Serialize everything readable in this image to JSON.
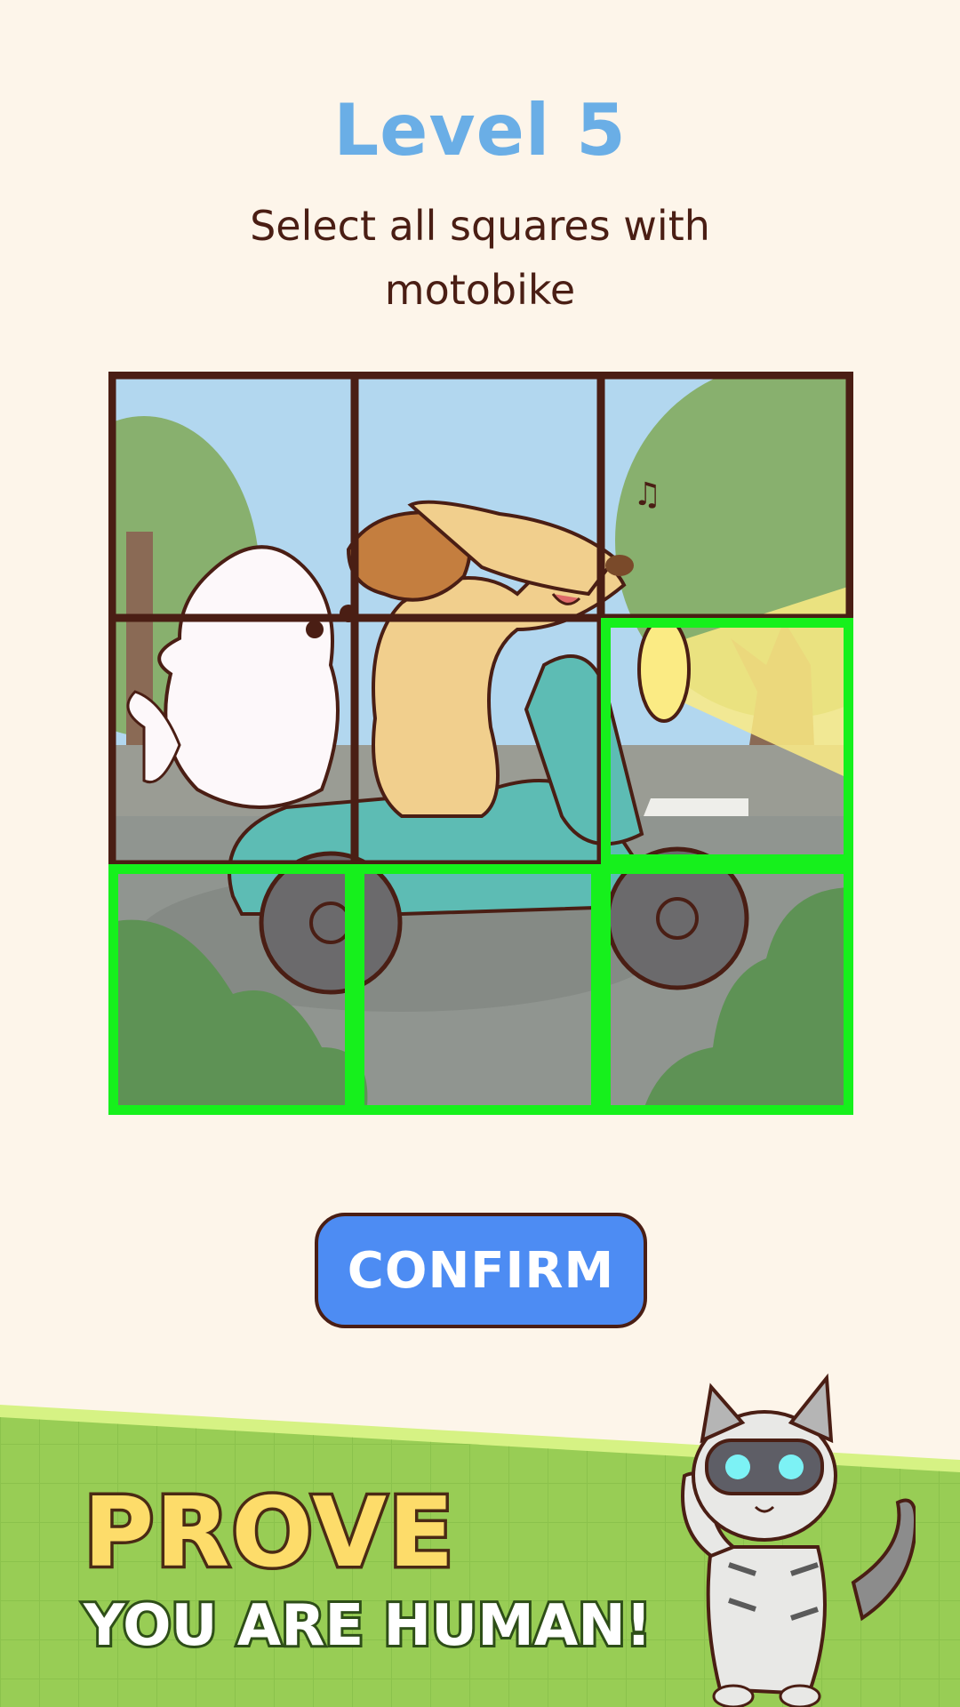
{
  "level_title": "Level 5",
  "instruction": "Select all squares with motobike",
  "grid": {
    "rows": 3,
    "cols": 3,
    "cells": [
      {
        "row": 0,
        "col": 0,
        "selected": false
      },
      {
        "row": 0,
        "col": 1,
        "selected": false
      },
      {
        "row": 0,
        "col": 2,
        "selected": false
      },
      {
        "row": 1,
        "col": 0,
        "selected": false
      },
      {
        "row": 1,
        "col": 1,
        "selected": false
      },
      {
        "row": 1,
        "col": 2,
        "selected": true
      },
      {
        "row": 2,
        "col": 0,
        "selected": true
      },
      {
        "row": 2,
        "col": 1,
        "selected": true
      },
      {
        "row": 2,
        "col": 2,
        "selected": true
      }
    ]
  },
  "confirm_label": "CONFIRM",
  "banner": {
    "headline": "PROVE",
    "subline": "YOU ARE HUMAN!"
  },
  "colors": {
    "background": "#fdf5ea",
    "title": "#6aaee6",
    "selection": "#16f01c",
    "button": "#4d8cf3",
    "banner_green": "#98cd55"
  }
}
